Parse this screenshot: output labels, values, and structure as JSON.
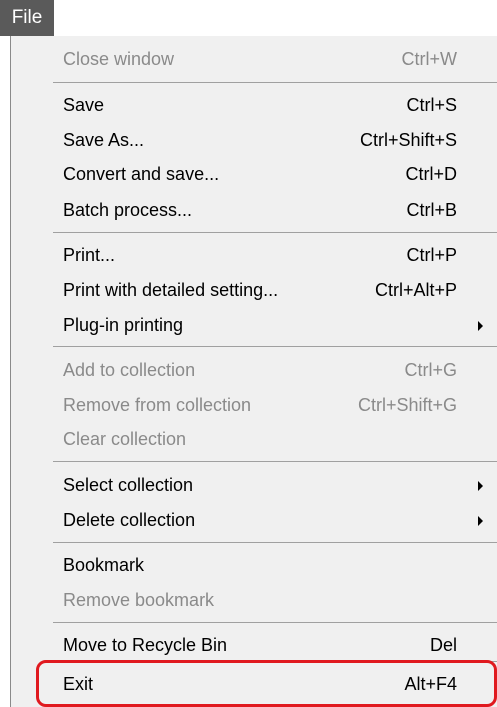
{
  "menubar": {
    "file_label": "File"
  },
  "menu": {
    "items": [
      {
        "label": "Close window",
        "shortcut": "Ctrl+W",
        "disabled": true
      },
      {
        "label": "Save",
        "shortcut": "Ctrl+S",
        "disabled": false
      },
      {
        "label": "Save As...",
        "shortcut": "Ctrl+Shift+S",
        "disabled": false
      },
      {
        "label": "Convert and save...",
        "shortcut": "Ctrl+D",
        "disabled": false
      },
      {
        "label": "Batch process...",
        "shortcut": "Ctrl+B",
        "disabled": false
      },
      {
        "label": "Print...",
        "shortcut": "Ctrl+P",
        "disabled": false
      },
      {
        "label": "Print with detailed setting...",
        "shortcut": "Ctrl+Alt+P",
        "disabled": false
      },
      {
        "label": "Plug-in printing",
        "shortcut": "",
        "disabled": false,
        "submenu": true
      },
      {
        "label": "Add to collection",
        "shortcut": "Ctrl+G",
        "disabled": true
      },
      {
        "label": "Remove from collection",
        "shortcut": "Ctrl+Shift+G",
        "disabled": true
      },
      {
        "label": "Clear collection",
        "shortcut": "",
        "disabled": true
      },
      {
        "label": "Select collection",
        "shortcut": "",
        "disabled": false,
        "submenu": true
      },
      {
        "label": "Delete collection",
        "shortcut": "",
        "disabled": false,
        "submenu": true
      },
      {
        "label": "Bookmark",
        "shortcut": "",
        "disabled": false
      },
      {
        "label": "Remove bookmark",
        "shortcut": "",
        "disabled": true
      },
      {
        "label": "Move to Recycle Bin",
        "shortcut": "Del",
        "disabled": false
      },
      {
        "label": "Exit",
        "shortcut": "Alt+F4",
        "disabled": false
      }
    ]
  },
  "colors": {
    "highlight_border": "#e0191f",
    "disabled_text": "#8a8a8a",
    "menubar_bg": "#5a5a5a",
    "menu_bg": "#f0f0f0"
  }
}
